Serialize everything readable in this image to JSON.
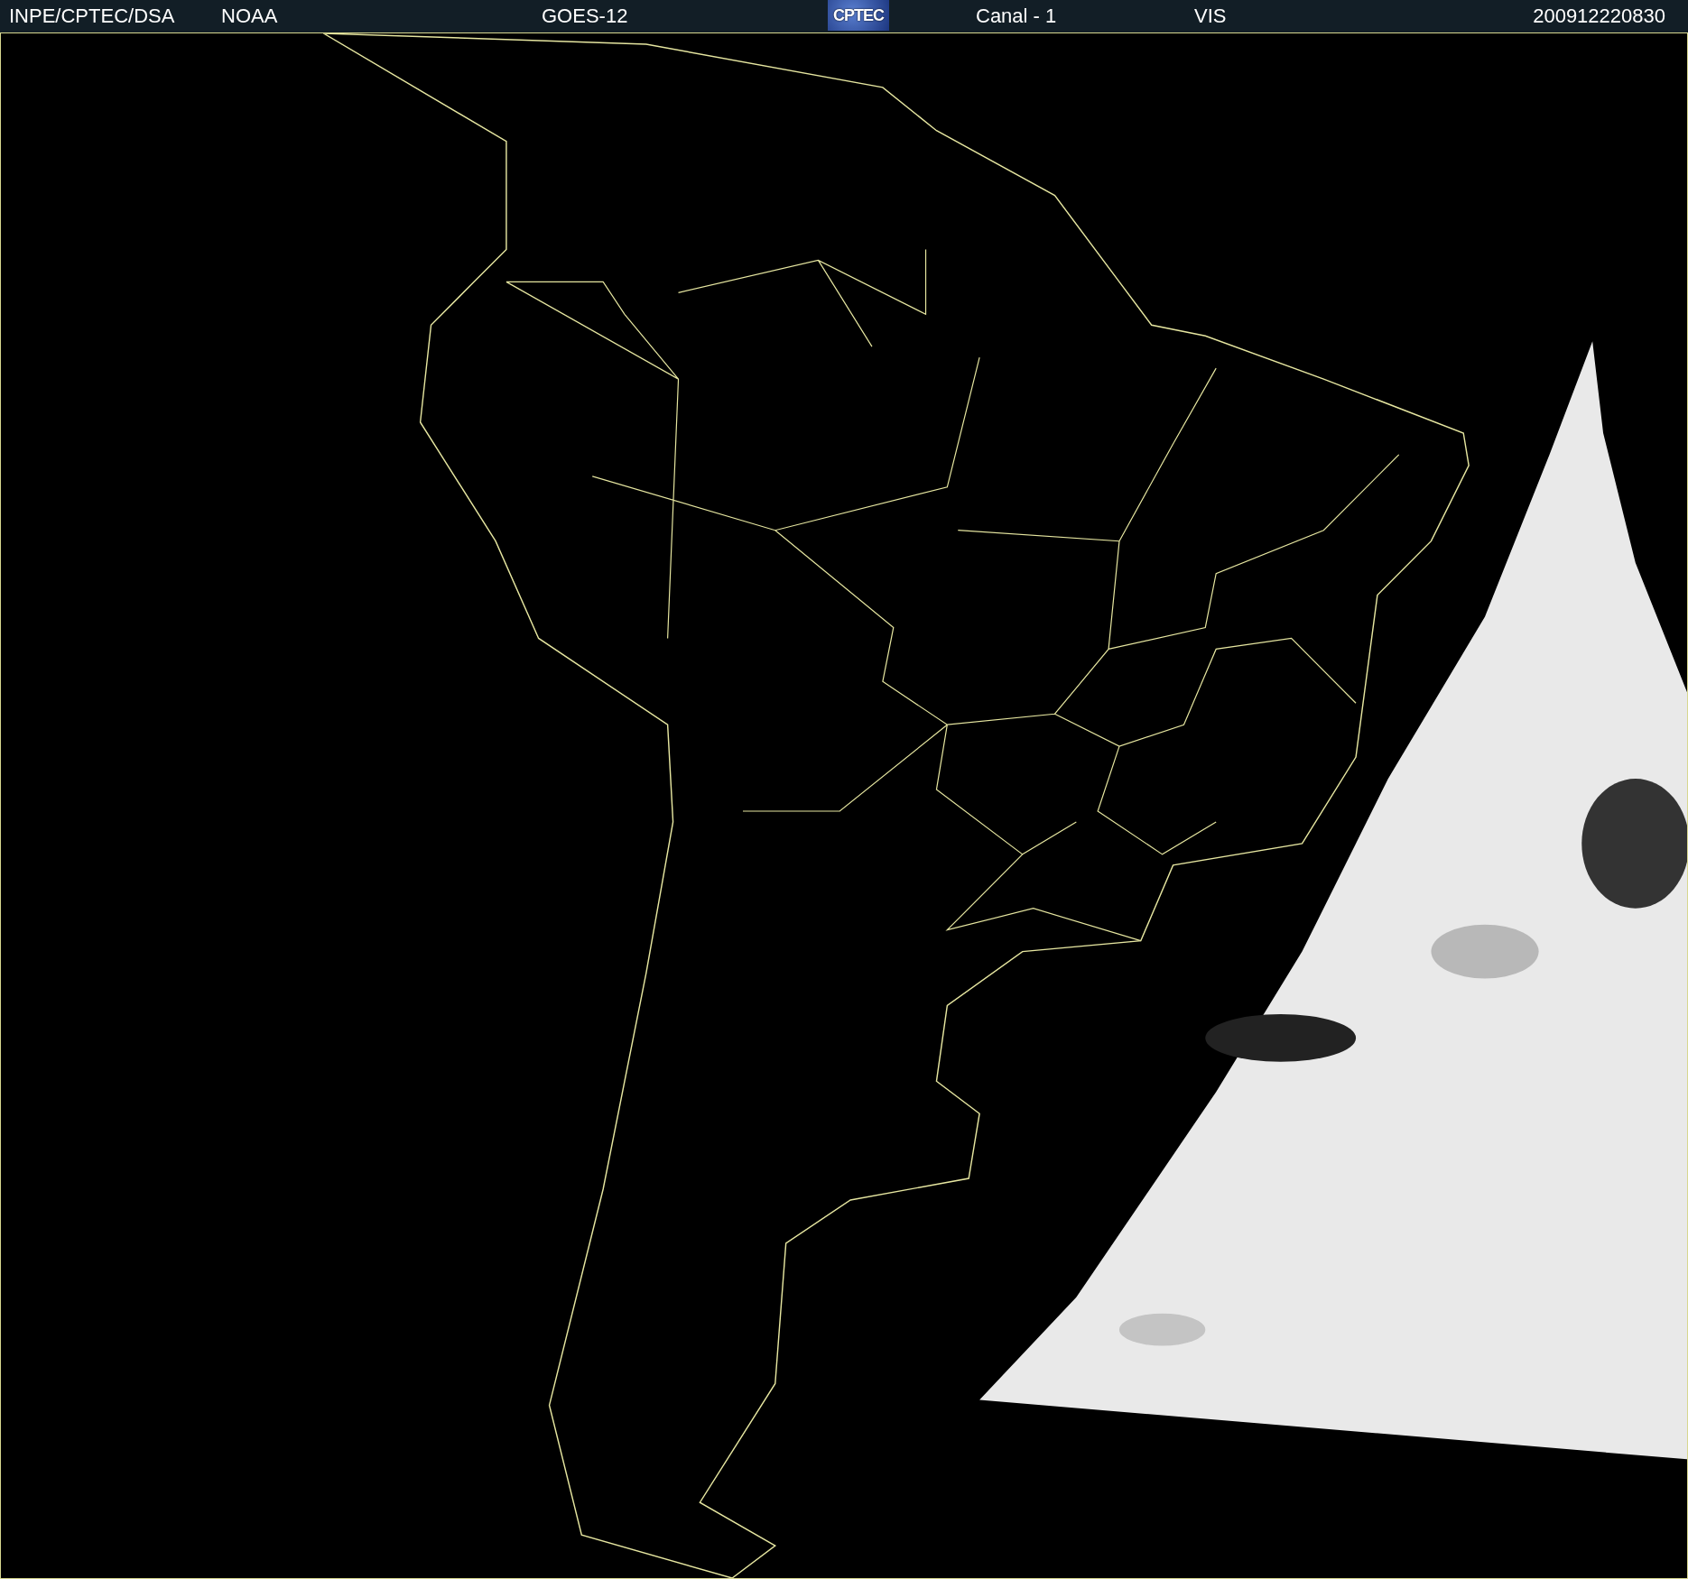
{
  "header": {
    "items": [
      {
        "kind": "text",
        "text": "INPE/CPTEC/DSA"
      },
      {
        "kind": "text",
        "text": "NOAA"
      },
      {
        "kind": "text",
        "text": "GOES-12"
      },
      {
        "kind": "logo",
        "text": "CPTEC"
      },
      {
        "kind": "text",
        "text": "Canal - 1"
      },
      {
        "kind": "text",
        "text": "VIS"
      },
      {
        "kind": "text",
        "text": "200912220830"
      }
    ]
  }
}
